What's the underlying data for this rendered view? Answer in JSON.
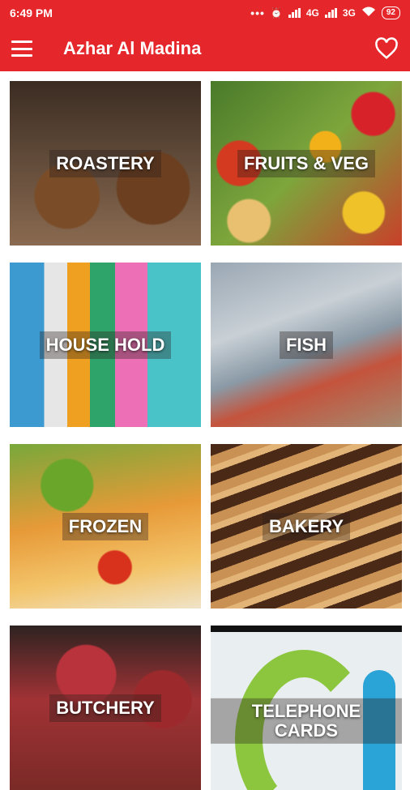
{
  "status_bar": {
    "time": "6:49 PM",
    "dots": "•••",
    "network_4g": "4G",
    "network_3g": "3G",
    "battery": "92"
  },
  "app_bar": {
    "title": "Azhar Al Madina"
  },
  "categories": [
    {
      "label": "ROASTERY"
    },
    {
      "label": "FRUITS & VEG"
    },
    {
      "label": "HOUSE HOLD"
    },
    {
      "label": "FISH"
    },
    {
      "label": "FROZEN"
    },
    {
      "label": "BAKERY"
    },
    {
      "label": "BUTCHERY"
    },
    {
      "label": "TELEPHONE CARDS"
    }
  ],
  "colors": {
    "brand_red": "#e5262a"
  }
}
